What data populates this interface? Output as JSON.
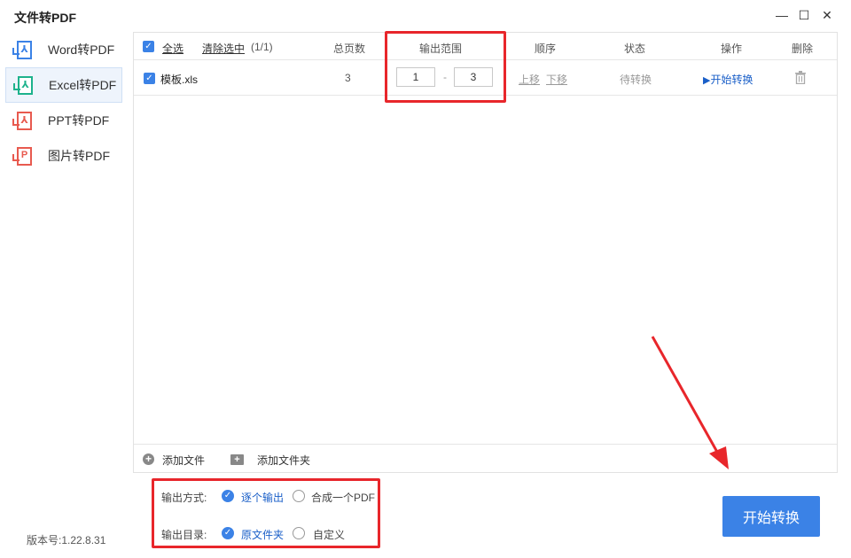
{
  "window": {
    "title": "文件转PDF",
    "controls": {
      "minimize": "—",
      "maximize": "☐",
      "close": "✕"
    }
  },
  "sidebar": {
    "items": [
      {
        "label": "Word转PDF",
        "icon": "word-pdf-icon",
        "glyph": "⅄",
        "color": "#3b82e6",
        "active": false
      },
      {
        "label": "Excel转PDF",
        "icon": "excel-pdf-icon",
        "glyph": "⅄",
        "color": "#1db28c",
        "active": true
      },
      {
        "label": "PPT转PDF",
        "icon": "ppt-pdf-icon",
        "glyph": "⅄",
        "color": "#e85a4f",
        "active": false
      },
      {
        "label": "图片转PDF",
        "icon": "image-pdf-icon",
        "glyph": "P",
        "color": "#e85a4f",
        "active": false
      }
    ]
  },
  "version": "版本号:1.22.8.31",
  "table": {
    "select_all": "全选",
    "clear_selection": "清除选中",
    "count": "(1/1)",
    "headers": {
      "pages": "总页数",
      "range": "输出范围",
      "order": "顺序",
      "status": "状态",
      "action": "操作",
      "delete": "删除"
    },
    "rows": [
      {
        "checked": true,
        "filename": "模板.xls",
        "pages": "3",
        "range_from": "1",
        "range_sep": "-",
        "range_to": "3",
        "move_up": "上移",
        "move_down": "下移",
        "status": "待转换",
        "action": "开始转换",
        "action_icon": "▶"
      }
    ]
  },
  "footer": {
    "add_file": "添加文件",
    "add_folder": "添加文件夹"
  },
  "options": {
    "output_mode_label": "输出方式:",
    "mode_each": "逐个输出",
    "mode_merge": "合成一个PDF",
    "output_dir_label": "输出目录:",
    "dir_source": "原文件夹",
    "dir_custom": "自定义"
  },
  "start_button": "开始转换",
  "colors": {
    "accent": "#3b82e6",
    "highlight": "#e8262b",
    "link": "#1a5fc8"
  }
}
